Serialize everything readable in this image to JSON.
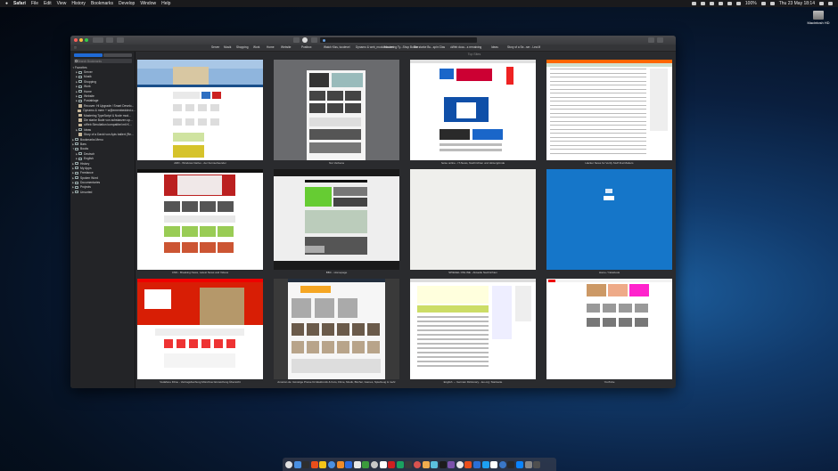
{
  "menubar": {
    "apple": "",
    "items": [
      "Safari",
      "File",
      "Edit",
      "View",
      "History",
      "Bookmarks",
      "Develop",
      "Window",
      "Help"
    ],
    "battery": "100%",
    "clock": "Thu 23 May 18:14"
  },
  "desktop": {
    "drive_label": "Macintosh HD"
  },
  "browser": {
    "favorites_bar": [
      "Server",
      "Musik",
      "Shopping",
      "Work",
      "Home",
      "Website",
      "Postbox",
      "Watch Kiss, tocdevel",
      "Dynamo & web_modules.com",
      "Mastering Ty...Shop Button",
      "Die starke Bu...spin Glas",
      "uWeb docu...s remaining",
      "Ideas",
      "Story of a Se...ser - Lea M"
    ],
    "top_sites_title": "Top Sites"
  },
  "sidebar": {
    "search_placeholder": "Search Bookmarks",
    "tree": [
      {
        "label": "Favorites",
        "level": 0,
        "arrow": "▼",
        "icon": "none"
      },
      {
        "label": "Server",
        "level": 1,
        "arrow": "▶",
        "icon": "folder"
      },
      {
        "label": "Musik",
        "level": 1,
        "arrow": "▶",
        "icon": "folder"
      },
      {
        "label": "Shopping",
        "level": 1,
        "arrow": "▶",
        "icon": "folder"
      },
      {
        "label": "Work",
        "level": 1,
        "arrow": "▶",
        "icon": "folder"
      },
      {
        "label": "Home",
        "level": 1,
        "arrow": "▶",
        "icon": "folder"
      },
      {
        "label": "Website",
        "level": 1,
        "arrow": "▶",
        "icon": "folder"
      },
      {
        "label": "Postablage",
        "level": 1,
        "arrow": "▶",
        "icon": "folder"
      },
      {
        "label": "Recover: Hi Upgrade / Smart Develo...",
        "level": 1,
        "arrow": "",
        "icon": "page"
      },
      {
        "label": "Dynamo & mem + w@emembedded.c...",
        "level": 1,
        "arrow": "",
        "icon": "page"
      },
      {
        "label": "Mastering TypeScript & Node mod...",
        "level": 1,
        "arrow": "",
        "icon": "page"
      },
      {
        "label": "Die starke Bude von achstanzen op...",
        "level": 1,
        "arrow": "",
        "icon": "page"
      },
      {
        "label": "uWeb Simuliation kompatibel mit K...",
        "level": 1,
        "arrow": "",
        "icon": "page"
      },
      {
        "label": "Ideas",
        "level": 1,
        "arrow": "▶",
        "icon": "folder"
      },
      {
        "label": "Story of a David von Apis ballert (Re...",
        "level": 1,
        "arrow": "",
        "icon": "page"
      },
      {
        "label": "Bookmarks Menu",
        "level": 0,
        "arrow": "▶",
        "icon": "folder"
      },
      {
        "label": "Bars",
        "level": 0,
        "arrow": "▶",
        "icon": "folder"
      },
      {
        "label": "Books",
        "level": 0,
        "arrow": "▼",
        "icon": "folder"
      },
      {
        "label": "Deutsch",
        "level": 1,
        "arrow": "▶",
        "icon": "folder"
      },
      {
        "label": "English",
        "level": 1,
        "arrow": "▶",
        "icon": "folder"
      },
      {
        "label": "History",
        "level": 0,
        "arrow": "▶",
        "icon": "folder"
      },
      {
        "label": "My Apps",
        "level": 0,
        "arrow": "▶",
        "icon": "folder"
      },
      {
        "label": "Freelance",
        "level": 0,
        "arrow": "▶",
        "icon": "folder"
      },
      {
        "label": "Spoken Word",
        "level": 0,
        "arrow": "▶",
        "icon": "folder"
      },
      {
        "label": "Documentaries",
        "level": 0,
        "arrow": "▶",
        "icon": "folder"
      },
      {
        "label": "Projects",
        "level": 0,
        "arrow": "▶",
        "icon": "folder"
      },
      {
        "label": "Unsorted",
        "level": 0,
        "arrow": "▶",
        "icon": "folder"
      }
    ]
  },
  "top_sites": [
    {
      "caption": "ARD - Windows Nativo - der Fernsehsender",
      "style": "ard"
    },
    {
      "caption": "Nur Verbena",
      "style": "grey"
    },
    {
      "caption": "heise online - IT-News, Nachrichten und Hintergründe",
      "style": "heise"
    },
    {
      "caption": "Hacker News for Verify Stuff that Matters",
      "style": "hn"
    },
    {
      "caption": "CNN - Breaking News, Latest News and Videos",
      "style": "cnn"
    },
    {
      "caption": "BBC - Homepage",
      "style": "bbc"
    },
    {
      "caption": "SPIEGEL ONLINE - Aktuelle Nachrichten",
      "style": "blank"
    },
    {
      "caption": "Home / Notebook",
      "style": "blue"
    },
    {
      "caption": "Vodafone Filme - Vertragsbuchung Münchner Einreichung Übersicht",
      "style": "red"
    },
    {
      "caption": "Amazon.de: Günstige Preise für Elektronik & Foto, Filme, Musik, Bücher, Games, Spielzeug & mehr",
      "style": "amazon"
    },
    {
      "caption": "English ⇔ German Dictionary - leo.org: Startseite",
      "style": "leo"
    },
    {
      "caption": "YouTube",
      "style": "youtube"
    }
  ],
  "dock_colors": [
    "#e0e0e0",
    "#4a90e2",
    "#2e2e2e",
    "#e94e1b",
    "#f5c518",
    "#4a90e2",
    "#f28c28",
    "#2d6cdf",
    "#e8e8e8",
    "#3c9a3c",
    "#c8c8c8",
    "#ffffff",
    "#d02020",
    "#1aa260",
    "#3a3a3a",
    "#d9534f",
    "#f0ad4e",
    "#5bc0de",
    "#1c1c1c",
    "#7b52ab",
    "#e8e8e8",
    "#e94e1b",
    "#2a6fd6",
    "#1da1f2",
    "#ffffff",
    "#3a77c6",
    "#2a2a2a",
    "#0a84ff",
    "#888888",
    "#4f4f4f"
  ]
}
